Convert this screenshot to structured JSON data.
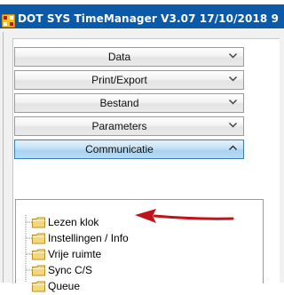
{
  "window": {
    "title": "DOT SYS TimeManager V3.07 17/10/2018 9",
    "icon": "app-grid-icon"
  },
  "menu": {
    "items": [
      {
        "label": "Data",
        "expanded": false
      },
      {
        "label": "Print/Export",
        "expanded": false
      },
      {
        "label": "Bestand",
        "expanded": false
      },
      {
        "label": "Parameters",
        "expanded": false
      },
      {
        "label": "Communicatie",
        "expanded": true
      }
    ]
  },
  "tree": {
    "items": [
      {
        "label": "Lezen klok",
        "icon": "folder-icon"
      },
      {
        "label": "Instellingen / Info",
        "icon": "folder-icon"
      },
      {
        "label": "Vrije ruimte",
        "icon": "folder-icon"
      },
      {
        "label": "Sync C/S",
        "icon": "folder-icon"
      },
      {
        "label": "Queue",
        "icon": "folder-icon"
      }
    ]
  },
  "annotation": {
    "arrow_color": "#c0141c",
    "points_to": "Instellingen / Info"
  },
  "colors": {
    "titlebar": "#0a5aa9",
    "active_button": "#b7dbf4",
    "button": "#ececec"
  }
}
